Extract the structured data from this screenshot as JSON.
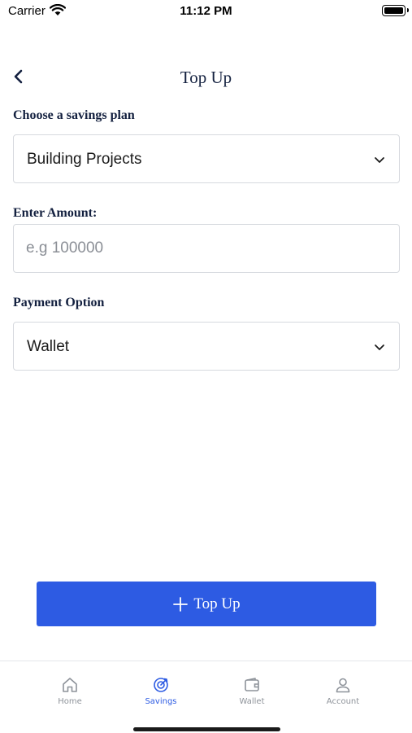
{
  "status_bar": {
    "carrier": "Carrier",
    "time": "11:12 PM"
  },
  "header": {
    "title": "Top Up"
  },
  "form": {
    "plan_label": "Choose a savings plan",
    "plan_value": "Building Projects",
    "amount_label": "Enter Amount:",
    "amount_placeholder": "e.g 100000",
    "amount_value": "",
    "payment_label": "Payment Option",
    "payment_value": "Wallet"
  },
  "primary_action": {
    "label": "Top Up"
  },
  "tab_bar": {
    "items": [
      {
        "label": "Home",
        "icon": "home-icon",
        "active": false
      },
      {
        "label": "Savings",
        "icon": "target-icon",
        "active": true
      },
      {
        "label": "Wallet",
        "icon": "wallet-icon",
        "active": false
      },
      {
        "label": "Account",
        "icon": "user-icon",
        "active": false
      }
    ]
  },
  "colors": {
    "accent": "#2d5be3",
    "heading": "#13203f",
    "inactive_tab": "#8e939a",
    "border": "#d6d9de"
  }
}
